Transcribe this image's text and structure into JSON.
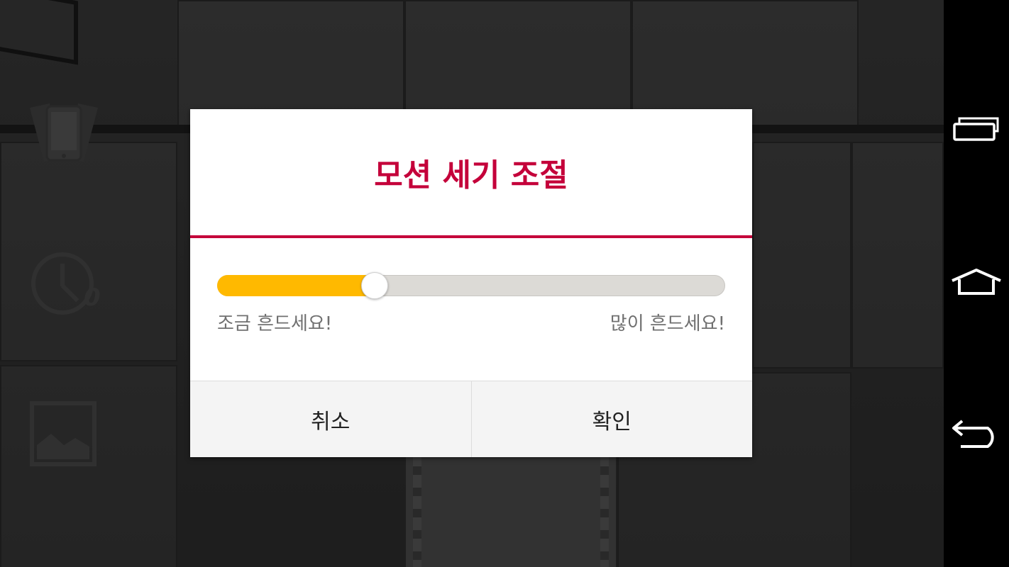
{
  "dialog": {
    "title": "모션 세기 조절",
    "slider": {
      "value": 0.31,
      "min_label": "조금 흔드세요!",
      "max_label": "많이 흔드세요!"
    },
    "cancel_label": "취소",
    "confirm_label": "확인"
  },
  "camera_controls": {
    "timer_count": "0",
    "icons": [
      "motion-shake-icon",
      "timer-icon",
      "gallery-icon"
    ]
  },
  "navbar": {
    "icons": [
      "recent-apps-icon",
      "home-icon",
      "back-icon"
    ]
  },
  "colors": {
    "accent": "#c4003a",
    "slider_fill": "#ffb900",
    "slider_track": "#dcdad6",
    "button_bar": "#f4f4f4"
  }
}
